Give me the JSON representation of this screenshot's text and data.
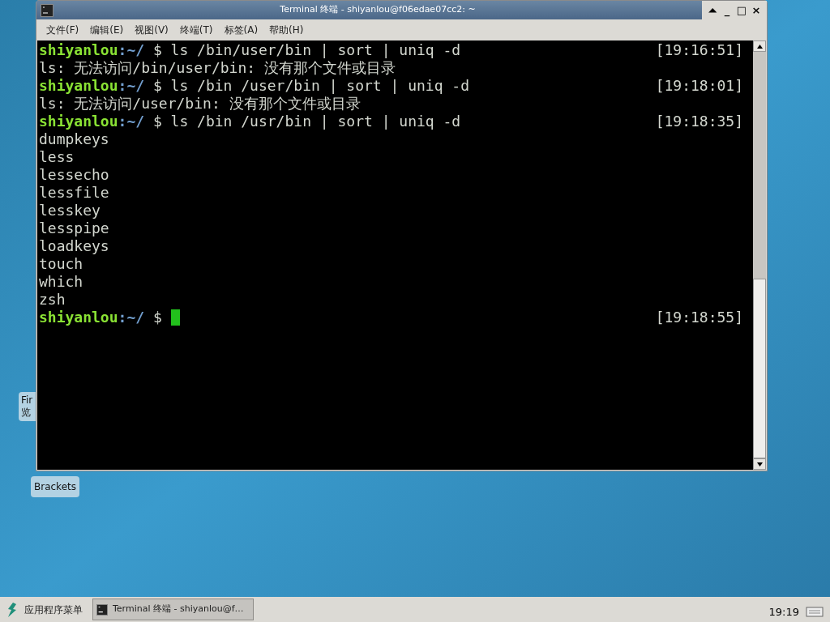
{
  "desktop_icons": [
    {
      "lines": [
        "Fir",
        "览"
      ]
    },
    {
      "lines": [
        "Brackets"
      ]
    }
  ],
  "window": {
    "title": "Terminal 终端 - shiyanlou@f06edae07cc2: ~",
    "controls": [
      "⏶",
      "_",
      "□",
      "×"
    ]
  },
  "menu": [
    "文件(F)",
    "编辑(E)",
    "视图(V)",
    "终端(T)",
    "标签(A)",
    "帮助(H)"
  ],
  "terminal": {
    "lines": [
      {
        "kind": "prompt",
        "user": "shiyanlou",
        "path": ":~/",
        "command": " $ ls /bin/user/bin | sort | uniq -d",
        "time": "[19:16:51]"
      },
      {
        "kind": "output",
        "text": "ls: 无法访问/bin/user/bin: 没有那个文件或目录"
      },
      {
        "kind": "prompt",
        "user": "shiyanlou",
        "path": ":~/",
        "command": " $ ls /bin /user/bin | sort | uniq -d",
        "time": "[19:18:01]"
      },
      {
        "kind": "output",
        "text": "ls: 无法访问/user/bin: 没有那个文件或目录"
      },
      {
        "kind": "prompt",
        "user": "shiyanlou",
        "path": ":~/",
        "command": " $ ls /bin /usr/bin | sort | uniq -d",
        "time": "[19:18:35]"
      },
      {
        "kind": "output",
        "text": "dumpkeys"
      },
      {
        "kind": "output",
        "text": "less"
      },
      {
        "kind": "output",
        "text": "lessecho"
      },
      {
        "kind": "output",
        "text": "lessfile"
      },
      {
        "kind": "output",
        "text": "lesskey"
      },
      {
        "kind": "output",
        "text": "lesspipe"
      },
      {
        "kind": "output",
        "text": "loadkeys"
      },
      {
        "kind": "output",
        "text": "touch"
      },
      {
        "kind": "output",
        "text": "which"
      },
      {
        "kind": "output",
        "text": "zsh"
      },
      {
        "kind": "prompt",
        "user": "shiyanlou",
        "path": ":~/",
        "command": " $ ",
        "time": "[19:18:55]",
        "cursor": true
      }
    ]
  },
  "taskbar": {
    "menu": "应用程序菜单",
    "tasks": [
      {
        "label": "Terminal 终端 - shiyanlou@f…",
        "selected": true
      }
    ],
    "clock": "19:19"
  }
}
